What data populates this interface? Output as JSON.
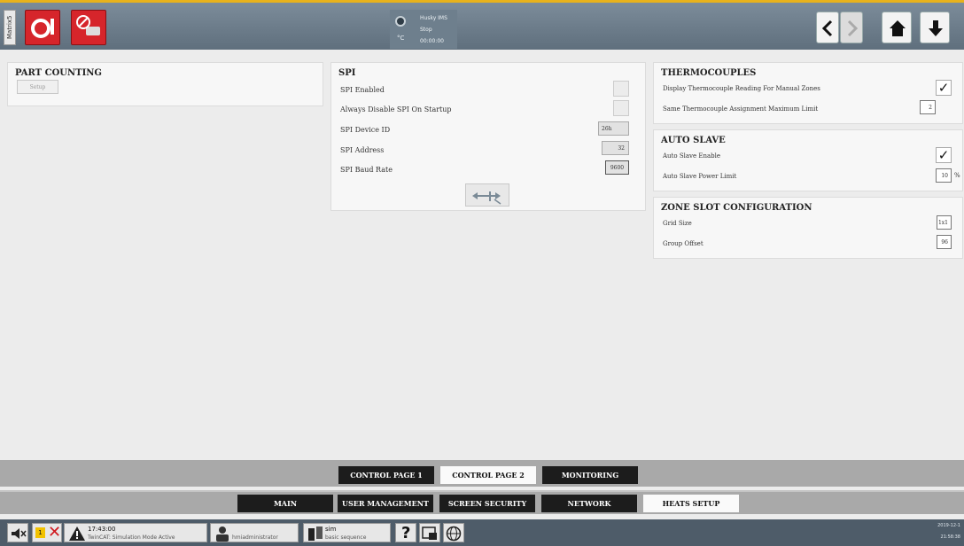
{
  "header": {
    "side_tab": "Matrix5",
    "status": {
      "line1": "Husky IMS",
      "line2": "Stop",
      "line3": "00:00:00",
      "sub": "°C"
    }
  },
  "part_counting": {
    "title": "PART COUNTING",
    "setup_label": "Setup"
  },
  "spi": {
    "title": "SPI",
    "rows": [
      {
        "label": "SPI Enabled"
      },
      {
        "label": "Always Disable SPI On Startup"
      },
      {
        "label": "SPI Device ID",
        "value": "26h"
      },
      {
        "label": "SPI Address",
        "value": "32"
      },
      {
        "label": "SPI Baud Rate",
        "value": "9600"
      }
    ]
  },
  "thermocouples": {
    "title": "THERMOCOUPLES",
    "rows": [
      {
        "label": "Display Thermocouple Reading For Manual Zones",
        "checked": true
      },
      {
        "label": "Same Thermocouple Assignment Maximum Limit",
        "value": "2"
      }
    ]
  },
  "auto_slave": {
    "title": "AUTO SLAVE",
    "rows": [
      {
        "label": "Auto Slave Enable",
        "checked": true
      },
      {
        "label": "Auto Slave Power Limit",
        "value": "10",
        "unit": "%"
      }
    ]
  },
  "zone_slot": {
    "title": "ZONE SLOT CONFIGURATION",
    "rows": [
      {
        "label": "Grid Size",
        "value": "1x1"
      },
      {
        "label": "Group Offset",
        "value": "96"
      }
    ]
  },
  "page_tabs": [
    "CONTROL PAGE 1",
    "CONTROL PAGE 2",
    "MONITORING"
  ],
  "page_tab_active": "CONTROL PAGE 2",
  "nav_tabs": [
    "MAIN",
    "USER MANAGEMENT",
    "SCREEN SECURITY",
    "NETWORK",
    "HEATS SETUP"
  ],
  "nav_tab_active": "HEATS SETUP",
  "bottom": {
    "alarm_time": "17:43:00",
    "alarm_text": "TwinCAT: Simulation Mode Active",
    "alarm_badge": "1",
    "user": "hmiadministrator",
    "seq_title": "sim",
    "seq_sub": "basic sequence",
    "date": "2019-12-1",
    "time": "21:58:38"
  },
  "colors": {
    "accent": "#e8b21c",
    "red": "#d6252b",
    "topbar": "#6e7f8d",
    "tab_dark": "#1c1c1c"
  }
}
